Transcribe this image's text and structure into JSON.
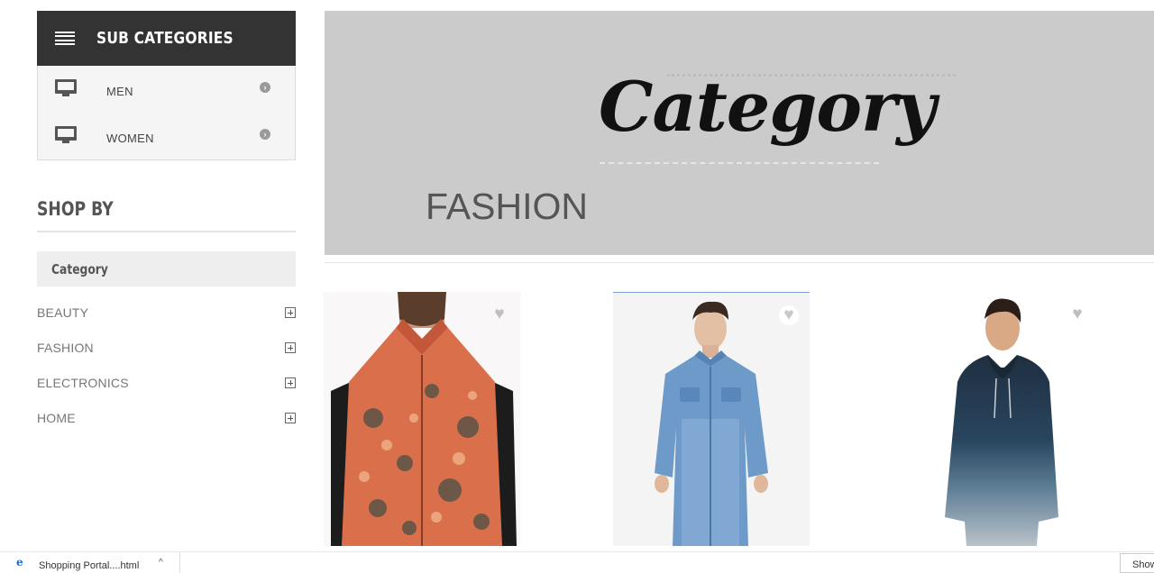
{
  "sidebar": {
    "subcategories_title": "SUB CATEGORIES",
    "subcategories": [
      {
        "label": "MEN",
        "icon": "monitor-icon"
      },
      {
        "label": "WOMEN",
        "icon": "monitor-icon"
      }
    ],
    "shop_by_title": "SHOP BY",
    "category_header": "Category",
    "categories": [
      {
        "label": "BEAUTY"
      },
      {
        "label": "FASHION"
      },
      {
        "label": "ELECTRONICS"
      },
      {
        "label": "HOME"
      }
    ]
  },
  "banner": {
    "script_text": "Category",
    "title": "FASHION"
  },
  "products": [
    {
      "image": "man in orange paisley nehru jacket",
      "wishlist_icon": "heart-icon"
    },
    {
      "image": "man in blue denim shirt",
      "wishlist_icon": "heart-icon"
    },
    {
      "image": "man in navy ombre hoodie",
      "wishlist_icon": "heart-icon"
    }
  ],
  "download_bar": {
    "file_name": "Shopping Portal....html",
    "show_all_label": "Show"
  },
  "colors": {
    "header_dark": "#333333",
    "banner_gray": "#cbcbcb"
  }
}
